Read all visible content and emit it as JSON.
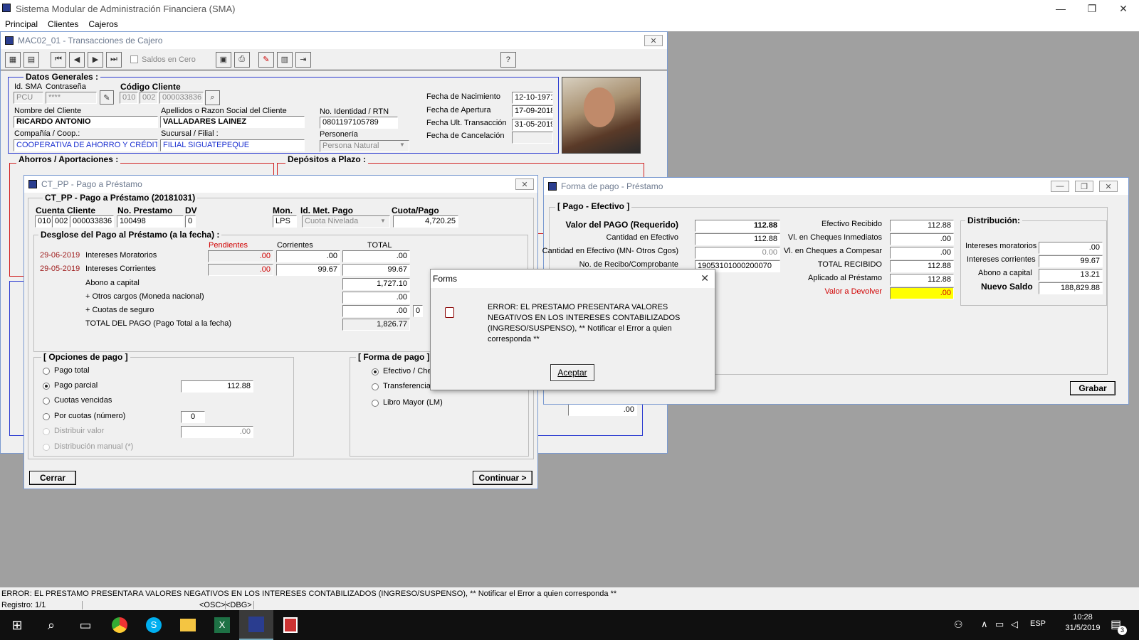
{
  "app": {
    "title": "Sistema Modular de Administración Financiera (SMA)",
    "menu": [
      "Principal",
      "Clientes",
      "Cajeros"
    ]
  },
  "cajero": {
    "title": "MAC02_01 - Transacciones de Cajero",
    "saldos_cero": "Saldos en Cero",
    "datos_generales": "Datos Generales :",
    "id_sma_label": "Id. SMA",
    "contrasena_label": "Contraseña",
    "codigo_cliente_label": "Código Cliente",
    "id_sma": "PCU",
    "contrasena": "****",
    "cod1": "010",
    "cod2": "002",
    "cod3": "000033836",
    "nombre_label": "Nombre del Cliente",
    "nombre": "RICARDO ANTONIO",
    "apellidos_label": "Apellidos o Razon Social del Cliente",
    "apellidos": "VALLADARES LAINEZ",
    "compania_label": "Compañía / Coop.:",
    "compania": "COOPERATIVA DE AHORRO Y CRÉDITO",
    "sucursal_label": "Sucursal / Filial :",
    "sucursal": "FILIAL SIGUATEPEQUE",
    "identidad_label": "No. Identidad / RTN",
    "identidad": "0801197105789",
    "personeria_label": "Personería",
    "personeria": "Persona Natural",
    "fecha_nac_label": "Fecha de Nacimiento",
    "fecha_nac": "12-10-1971",
    "fecha_apertura_label": "Fecha de  Apertura",
    "fecha_apertura": "17-09-2018",
    "fecha_ult_label": "Fecha Ult. Transacción",
    "fecha_ult": "31-05-2019",
    "fecha_cancel_label": "Fecha de Cancelación",
    "fecha_cancel": "",
    "ahorros": "Ahorros / Aportaciones :",
    "depositos": "Depósitos a Plazo :",
    "bg_value": ".00"
  },
  "pago": {
    "title": "CT_PP - Pago a Préstamo",
    "heading": "CT_PP - Pago a Préstamo (20181031)",
    "cuenta_label": "Cuenta Cliente",
    "prestamo_label": "No. Prestamo",
    "dv_label": "DV",
    "mon_label": "Mon.",
    "metodo_label": "Id. Met. Pago",
    "cuota_label": "Cuota/Pago",
    "cta1": "010",
    "cta2": "002",
    "cta3": "000033836",
    "prestamo": "100498",
    "dv": "0",
    "mon": "LPS",
    "metodo": "Cuota Nivelada",
    "cuota": "4,720.25",
    "desglose": "Desglose del Pago al Préstamo (a la fecha) :",
    "col_pend": "Pendientes",
    "col_corr": "Corrientes",
    "col_total": "TOTAL",
    "fecha1": "29-06-2019",
    "int_mor": "Intereses Moratorios",
    "fecha2": "29-05-2019",
    "int_corr": "Intereses Corrientes",
    "mor_pend": ".00",
    "mor_corr": ".00",
    "mor_total": ".00",
    "corr_pend": ".00",
    "corr_corr": "99.67",
    "corr_total": "99.67",
    "abono_label": "Abono a capital",
    "abono": "1,727.10",
    "otros_label": "+ Otros cargos (Moneda nacional)",
    "otros": ".00",
    "seguro_label": "+ Cuotas de seguro",
    "seguro": ".00",
    "seguro_extra": "0",
    "total_label": "TOTAL DEL PAGO (Pago Total a la fecha)",
    "total": "1,826.77",
    "opciones": "[ Opciones de pago ]",
    "opt1": "Pago total",
    "opt2": "Pago parcial",
    "opt2_val": "112.88",
    "opt3": "Cuotas vencidas",
    "opt4": "Por cuotas (número)",
    "opt4_val": "0",
    "opt5": "Distribuir valor",
    "opt5_val": ".00",
    "opt6": "Distribución manual (*)",
    "forma": "[ Forma de pago ]",
    "f1": "Efectivo / Che",
    "f2": "Transferencia interna (TI)",
    "f3": "Libro Mayor (LM)",
    "cerrar": "Cerrar",
    "continuar": "Continuar >"
  },
  "forma": {
    "title": "Forma de pago - Préstamo",
    "heading": "[ Pago - Efectivo ]",
    "valor_label": "Valor del PAGO (Requerido)",
    "valor": "112.88",
    "cant_label": "Cantidad en Efectivo",
    "cant": "112.88",
    "cant_mn_label": "Cantidad en Efectivo (MN- Otros Cgos)",
    "cant_mn": "0.00",
    "recibo_label": "No. de Recibo/Comprobante",
    "recibo": "19053101000200070",
    "ef_rec_label": "Efectivo Recibido",
    "ef_rec": "112.88",
    "vl_inm_label": "Vl. en Cheques Inmediatos",
    "vl_inm": ".00",
    "vl_comp_label": "Vl. en Cheques a Compesar",
    "vl_comp": ".00",
    "total_rec_label": "TOTAL RECIBIDO",
    "total_rec": "112.88",
    "aplicado_label": "Aplicado al Préstamo",
    "aplicado": "112.88",
    "devolver_label": "Valor a Devolver",
    "devolver": ".00",
    "distrib": "Distribución:",
    "d_mor_label": "Intereses moratorios",
    "d_mor": ".00",
    "d_corr_label": "Intereses corrientes",
    "d_corr": "99.67",
    "d_abono_label": "Abono a capital",
    "d_abono": "13.21",
    "nuevo_label": "Nuevo Saldo",
    "nuevo": "188,829.88",
    "grabar": "Grabar"
  },
  "dialog": {
    "title": "Forms",
    "message": "ERROR: EL PRESTAMO PRESENTARA VALORES NEGATIVOS EN LOS INTERESES CONTABILIZADOS (INGRESO/SUSPENSO), ** Notificar el Error a quien corresponda **",
    "ok": "Aceptar"
  },
  "status": {
    "message": "ERROR: EL PRESTAMO PRESENTARA VALORES NEGATIVOS EN LOS INTERESES CONTABILIZADOS (INGRESO/SUSPENSO), ** Notificar el Error a quien corresponda **",
    "registro": "Registro: 1/1",
    "osc": "<OSC>",
    "dbg": "<DBG>"
  },
  "taskbar": {
    "lang": "ESP",
    "time": "10:28",
    "date": "31/5/2019",
    "notif": "3"
  }
}
